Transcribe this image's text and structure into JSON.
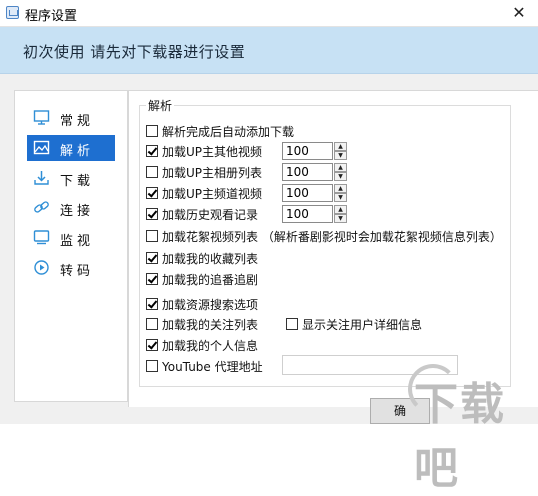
{
  "window": {
    "title": "程序设置"
  },
  "header": {
    "text": "初次使用 请先对下载器进行设置"
  },
  "sidebar": {
    "items": [
      {
        "label": "常规",
        "icon": "monitor-icon"
      },
      {
        "label": "解析",
        "icon": "image-icon",
        "active": true
      },
      {
        "label": "下载",
        "icon": "download-icon"
      },
      {
        "label": "连接",
        "icon": "link-icon"
      },
      {
        "label": "监视",
        "icon": "screen-icon"
      },
      {
        "label": "转码",
        "icon": "convert-icon"
      }
    ]
  },
  "parse": {
    "group_title": "解析",
    "options": [
      {
        "label": "解析完成后自动添加下载",
        "checked": false
      },
      {
        "label": "加载UP主其他视频",
        "checked": true,
        "value": "100"
      },
      {
        "label": "加载UP主相册列表",
        "checked": false,
        "value": "100"
      },
      {
        "label": "加载UP主频道视频",
        "checked": true,
        "value": "100"
      },
      {
        "label": "加载历史观看记录",
        "checked": true,
        "value": "100"
      },
      {
        "label": "加载花絮视频列表 （解析番剧影视时会加载花絮视频信息列表）",
        "checked": false
      },
      {
        "label": "加载我的收藏列表",
        "checked": true
      },
      {
        "label": "加载我的追番追剧",
        "checked": true
      },
      {
        "label": "加载资源搜索选项",
        "checked": true
      },
      {
        "label": "加载我的关注列表",
        "checked": false
      },
      {
        "label": "显示关注用户详细信息",
        "checked": false
      },
      {
        "label": "加载我的个人信息",
        "checked": true
      },
      {
        "label": "YouTube 代理地址",
        "checked": false,
        "value": ""
      }
    ]
  },
  "buttons": {
    "ok": "确"
  },
  "watermark": {
    "text": "下载吧"
  },
  "colors": {
    "header_bg": "#c7e1f4",
    "active_nav": "#1e6fd0",
    "icon": "#2f8fd6"
  }
}
